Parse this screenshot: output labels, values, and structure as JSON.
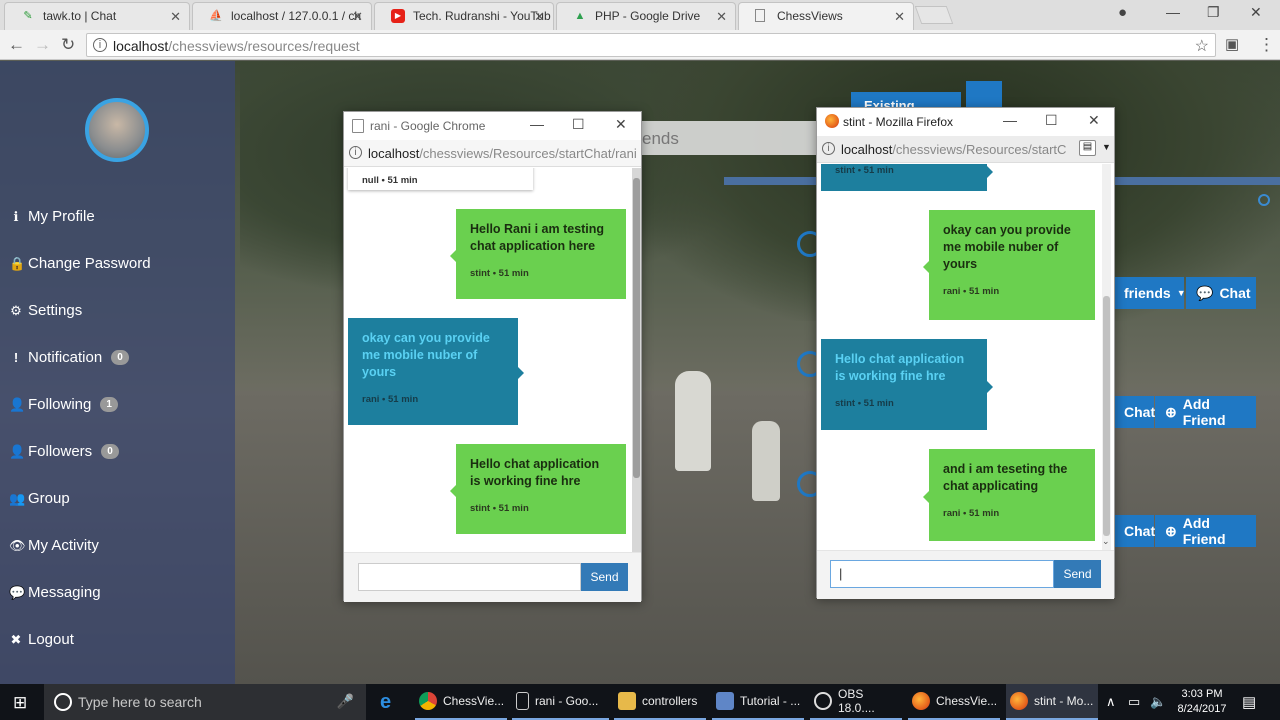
{
  "browser": {
    "tabs": [
      {
        "label": "tawk.to | Chat",
        "icon": "tawk-icon"
      },
      {
        "label": "localhost / 127.0.0.1 / ch",
        "icon": "phpmyadmin-icon"
      },
      {
        "label": "Tech. Rudranshi - YouTub",
        "icon": "youtube-icon"
      },
      {
        "label": "PHP - Google Drive",
        "icon": "google-drive-icon"
      },
      {
        "label": "ChessViews",
        "icon": "page-icon"
      }
    ],
    "url_host": "localhost",
    "url_path": "/chessviews/resources/request"
  },
  "sidebar": {
    "items": [
      {
        "label": "My Profile",
        "icon": "info-icon",
        "glyph": "ℹ"
      },
      {
        "label": "Change Password",
        "icon": "lock-icon",
        "glyph": "🔒"
      },
      {
        "label": "Settings",
        "icon": "gear-icon",
        "glyph": "⚙"
      },
      {
        "label": "Notification",
        "icon": "exclamation-icon",
        "glyph": "!",
        "badge": "0"
      },
      {
        "label": "Following",
        "icon": "user-add-icon",
        "glyph": "👤",
        "badge": "1"
      },
      {
        "label": "Followers",
        "icon": "user-add-icon",
        "glyph": "👤",
        "badge": "0"
      },
      {
        "label": "Group",
        "icon": "users-icon",
        "glyph": "👥"
      },
      {
        "label": "My Activity",
        "icon": "eye-icon",
        "glyph": "👁"
      },
      {
        "label": "Messaging",
        "icon": "comments-icon",
        "glyph": "💬"
      },
      {
        "label": "Logout",
        "icon": "close-icon",
        "glyph": "✖"
      }
    ]
  },
  "page": {
    "friends_header": "ends",
    "existing_friends": "Existing friends",
    "friends_dropdown": "friends",
    "chat_label": "Chat",
    "add_friend_label": "Add Friend"
  },
  "chrome_popup": {
    "title": "rani - Google Chrome",
    "url_host": "localhost",
    "url_path": "/chessviews/Resources/startChat/rani",
    "top_partial": "null • 51 min",
    "messages": [
      {
        "text": "Hello Rani i am testing chat application here",
        "meta": "stint • 51 min",
        "side": "right"
      },
      {
        "text": "okay can you provide me mobile nuber of yours",
        "meta": "rani • 51 min",
        "side": "left"
      },
      {
        "text": "Hello chat application is working fine hre",
        "meta": "stint • 51 min",
        "side": "right"
      }
    ],
    "send": "Send"
  },
  "firefox_popup": {
    "title": "stint - Mozilla Firefox",
    "url_host": "localhost",
    "url_path": "/chessviews/Resources/startC",
    "top_partial": "stint • 51 min",
    "messages": [
      {
        "text": "okay can you provide me mobile nuber of yours",
        "meta": "rani • 51 min",
        "side": "right"
      },
      {
        "text": "Hello chat application is working fine hre",
        "meta": "stint • 51 min",
        "side": "left"
      },
      {
        "text": "and i am teseting the chat applicating",
        "meta": "rani • 51 min",
        "side": "right"
      }
    ],
    "input_value": "|",
    "send": "Send"
  },
  "taskbar": {
    "search_placeholder": "Type here to search",
    "items": [
      {
        "label": "ChessVie...",
        "icon": "chrome-icon"
      },
      {
        "label": "rani - Goo...",
        "icon": "page-icon"
      },
      {
        "label": "controllers",
        "icon": "folder-icon"
      },
      {
        "label": "Tutorial - ...",
        "icon": "virtualbox-icon"
      },
      {
        "label": "OBS 18.0....",
        "icon": "obs-icon"
      },
      {
        "label": "ChessVie...",
        "icon": "firefox-icon"
      },
      {
        "label": "stint - Mo...",
        "icon": "firefox-icon"
      }
    ],
    "time": "3:03 PM",
    "date": "8/24/2017"
  }
}
